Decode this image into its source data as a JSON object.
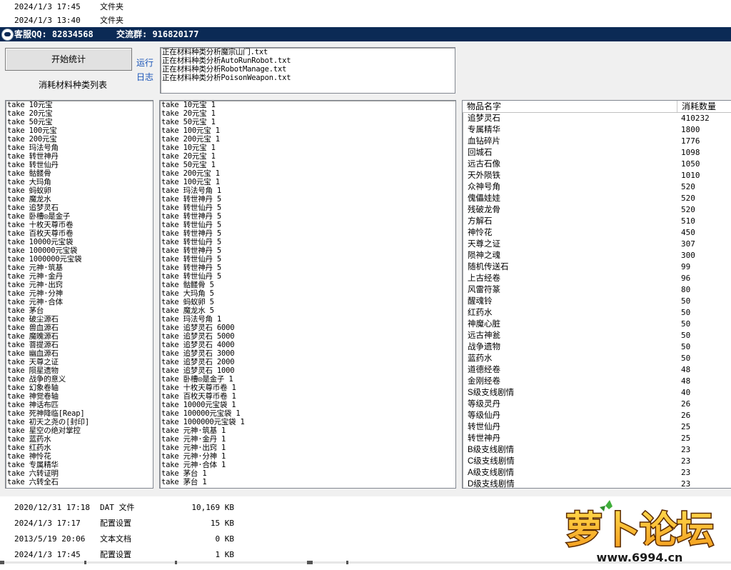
{
  "explorer_top": [
    {
      "date": "2024/1/3 17:45",
      "type": "文件夹"
    },
    {
      "date": "2024/1/3 13:40",
      "type": "文件夹"
    }
  ],
  "titlebar": {
    "qq": "客服QQ: 82834568",
    "group": "交流群: 916820177"
  },
  "controls": {
    "start_button": "开始统计",
    "list_title": "消耗材料种类列表",
    "side_label": "运行日志"
  },
  "log_lines": [
    "正在材料种类分析魔宗山门.txt",
    "正在材料种类分析AutoRunRobot.txt",
    "正在材料种类分析RobotManage.txt",
    "正在材料种类分析PoisonWeapon.txt"
  ],
  "types_list": [
    "take 10元宝",
    "take 20元宝",
    "take 50元宝",
    "take 100元宝",
    "take 200元宝",
    "take 玛法号角",
    "take 转世神丹",
    "take 转世仙丹",
    "take 骷髅骨",
    "take 大玛角",
    "take 蚂蚁卵",
    "take 魔龙水",
    "take 追梦灵石",
    "take 卧槽◎是金子",
    "take 十枚天尊币卷",
    "take 百枚天尊币卷",
    "take 10000元宝袋",
    "take 100000元宝袋",
    "take 1000000元宝袋",
    "take 元神·筑基",
    "take 元神·金丹",
    "take 元神·出窍",
    "take 元神·分神",
    "take 元神·合体",
    "take 茅台",
    "take 破尘源石",
    "take 兽血源石",
    "take 魔魄源石",
    "take 菩提源石",
    "take 幽血源石",
    "take 天尊之证",
    "take 陨星遗物",
    "take 战争的意义",
    "take 幻象卷轴",
    "take 神觉卷轴",
    "take 神话布匹",
    "take 死神降临[Reap]",
    "take 初天之尧の[封印]",
    "take 星空の绝对掌控",
    "take 蓝药水",
    "take 红药水",
    "take 神怜花",
    "take 专属精华",
    "take 六转证明",
    "take 六转全石"
  ],
  "detail_list": [
    "take 10元宝 1",
    "take 20元宝 1",
    "take 50元宝 1",
    "take 100元宝 1",
    "take 200元宝 1",
    "take 10元宝 1",
    "take 20元宝 1",
    "take 50元宝 1",
    "take 200元宝 1",
    "take 100元宝 1",
    "take 玛法号角 1",
    "take 转世神丹 5",
    "take 转世仙丹 5",
    "take 转世神丹 5",
    "take 转世仙丹 5",
    "take 转世神丹 5",
    "take 转世仙丹 5",
    "take 转世神丹 5",
    "take 转世仙丹 5",
    "take 转世神丹 5",
    "take 转世仙丹 5",
    "take 骷髅骨 5",
    "take 大玛角 5",
    "take 蚂蚁卵 5",
    "take 魔龙水 5",
    "take 玛法号角 1",
    "take 追梦灵石 6000",
    "take 追梦灵石 5000",
    "take 追梦灵石 4000",
    "take 追梦灵石 3000",
    "take 追梦灵石 2000",
    "take 追梦灵石 1000",
    "take 卧槽◎是金子 1",
    "take 十枚天尊币卷 1",
    "take 百枚天尊币卷 1",
    "take 10000元宝袋 1",
    "take 100000元宝袋 1",
    "take 1000000元宝袋 1",
    "take 元神·筑基 1",
    "take 元神·金丹 1",
    "take 元神·出窍 1",
    "take 元神·分神 1",
    "take 元神·合体 1",
    "take 茅台 1",
    "take 茅台 1"
  ],
  "table": {
    "headers": [
      "物品名字",
      "消耗数量"
    ],
    "rows": [
      [
        "追梦灵石",
        "410232"
      ],
      [
        "专属精华",
        "1800"
      ],
      [
        "血钻碎片",
        "1776"
      ],
      [
        "回城石",
        "1098"
      ],
      [
        "远古石像",
        "1050"
      ],
      [
        "天外陨铁",
        "1010"
      ],
      [
        "众神号角",
        "520"
      ],
      [
        "傀儡娃娃",
        "520"
      ],
      [
        "残破龙骨",
        "520"
      ],
      [
        "方解石",
        "510"
      ],
      [
        "神怜花",
        "450"
      ],
      [
        "天尊之证",
        "307"
      ],
      [
        "陨神之魂",
        "300"
      ],
      [
        "随机传送石",
        "99"
      ],
      [
        "上古经卷",
        "96"
      ],
      [
        "风雷符篆",
        "80"
      ],
      [
        "醒魂铃",
        "50"
      ],
      [
        "红药水",
        "50"
      ],
      [
        "神魔心脏",
        "50"
      ],
      [
        "远古神瓮",
        "50"
      ],
      [
        "战争遗物",
        "50"
      ],
      [
        "蓝药水",
        "50"
      ],
      [
        "道德经卷",
        "48"
      ],
      [
        "金刚经卷",
        "48"
      ],
      [
        "S级支线剧情",
        "40"
      ],
      [
        "等级灵丹",
        "26"
      ],
      [
        "等级仙丹",
        "26"
      ],
      [
        "转世仙丹",
        "25"
      ],
      [
        "转世神丹",
        "25"
      ],
      [
        "B级支线剧情",
        "23"
      ],
      [
        "C级支线剧情",
        "23"
      ],
      [
        "A级支线剧情",
        "23"
      ],
      [
        "D级支线剧情",
        "23"
      ]
    ]
  },
  "explorer_bottom": [
    {
      "date": "2020/12/31 17:18",
      "type": "DAT 文件",
      "size": "10,169 KB"
    },
    {
      "date": "2024/1/3 17:17",
      "type": "配置设置",
      "size": "15 KB"
    },
    {
      "date": "2013/5/19 20:06",
      "type": "文本文档",
      "size": "0 KB"
    },
    {
      "date": "2024/1/3 17:45",
      "type": "配置设置",
      "size": "1 KB"
    }
  ],
  "watermark": {
    "brand": "萝卜论坛",
    "url": "www.6994.cn"
  }
}
